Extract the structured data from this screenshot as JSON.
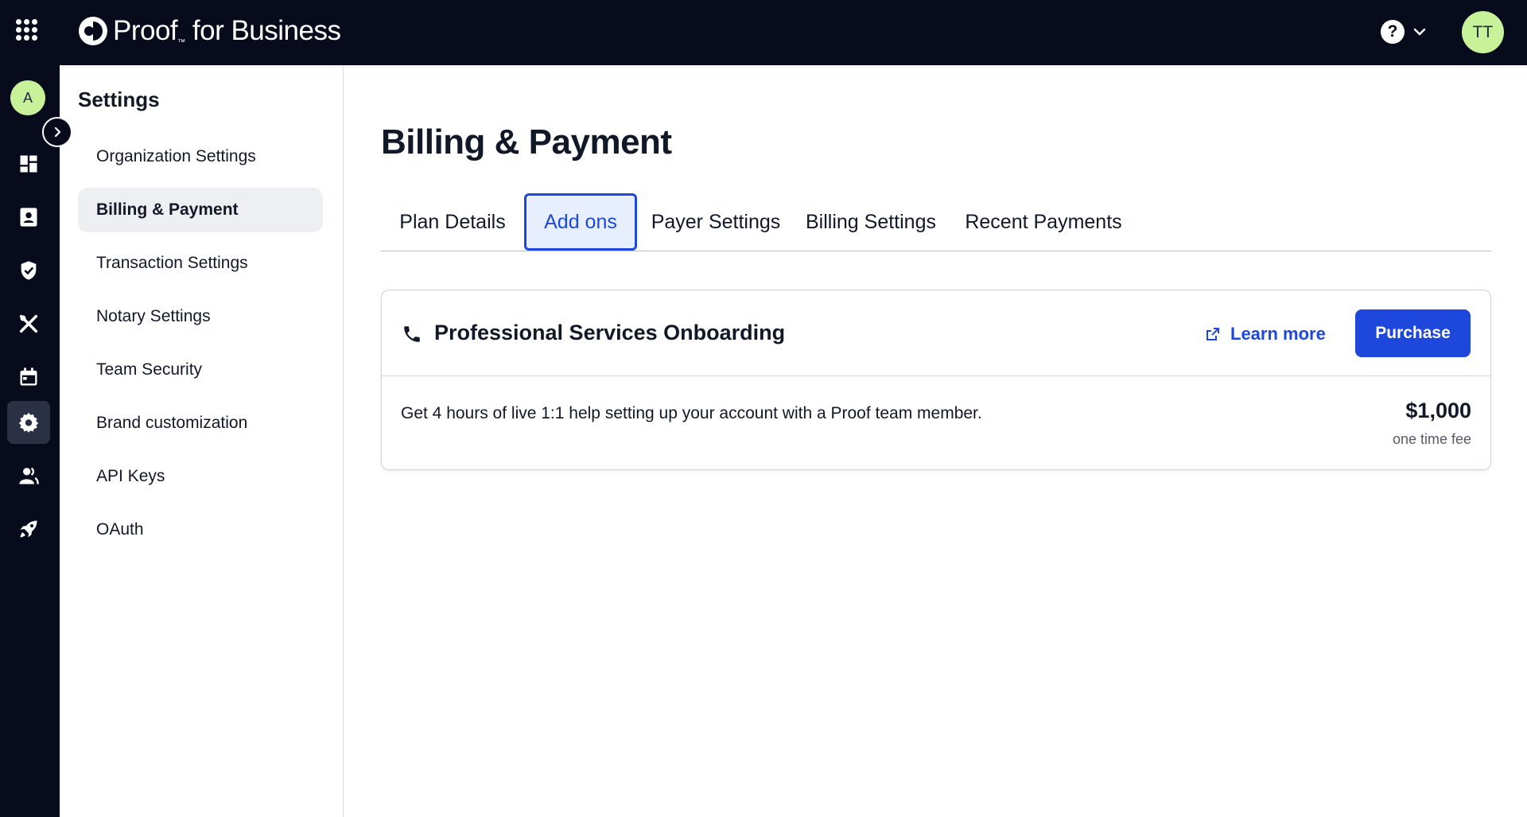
{
  "topbar": {
    "brand": "Proof",
    "brand_suffix": "for Business",
    "help_symbol": "?",
    "user_initials": "TT"
  },
  "rail": {
    "user_initial": "A",
    "items": [
      {
        "icon": "dashboard-icon"
      },
      {
        "icon": "contact-card-icon"
      },
      {
        "icon": "shield-check-icon"
      },
      {
        "icon": "tools-icon"
      },
      {
        "icon": "calendar-icon"
      },
      {
        "icon": "gear-icon",
        "active": true
      },
      {
        "icon": "users-icon"
      },
      {
        "icon": "rocket-icon"
      }
    ]
  },
  "settings": {
    "title": "Settings",
    "items": [
      {
        "label": "Organization Settings"
      },
      {
        "label": "Billing & Payment",
        "active": true
      },
      {
        "label": "Transaction Settings"
      },
      {
        "label": "Notary Settings"
      },
      {
        "label": "Team Security"
      },
      {
        "label": "Brand customization"
      },
      {
        "label": "API Keys"
      },
      {
        "label": "OAuth"
      }
    ]
  },
  "main": {
    "title": "Billing & Payment",
    "tabs": [
      {
        "label": "Plan Details"
      },
      {
        "label": "Add ons",
        "active": true
      },
      {
        "label": "Payer Settings"
      },
      {
        "label": "Billing Settings"
      },
      {
        "label": "Recent Payments"
      }
    ],
    "addon": {
      "title": "Professional Services Onboarding",
      "learn_more": "Learn more",
      "purchase": "Purchase",
      "description": "Get 4 hours of live 1:1 help setting up your account with a Proof team member.",
      "price": "$1,000",
      "price_note": "one time fee"
    }
  },
  "colors": {
    "nav_bg": "#070b1c",
    "accent": "#1e47dc",
    "avatar_bg": "#c7f29a",
    "active_tab_bg": "#e7efff"
  }
}
